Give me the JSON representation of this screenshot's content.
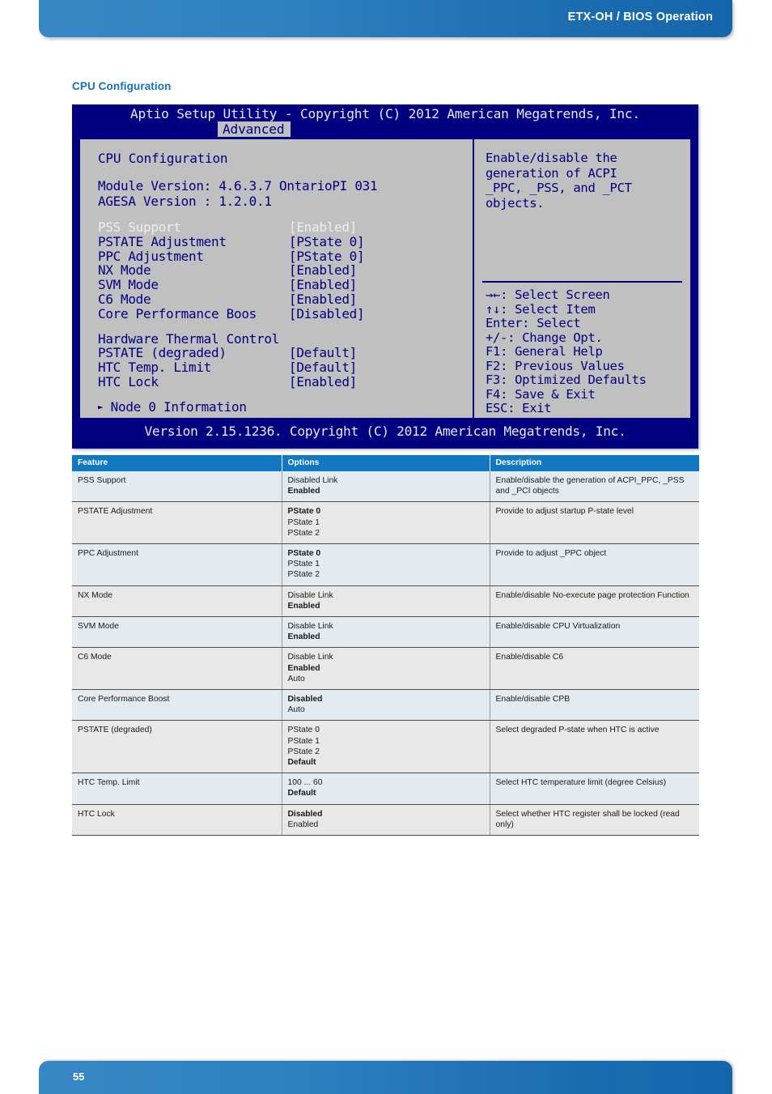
{
  "header": {
    "title": "ETX-OH / BIOS Operation"
  },
  "section": {
    "title": "CPU Configuration"
  },
  "footer": {
    "page_number": "55",
    "accent_color": "#1e6eb2"
  },
  "bios": {
    "title": "Aptio Setup Utility - Copyright (C) 2012 American Megatrends, Inc.",
    "tab": "Advanced",
    "panel_heading": "CPU Configuration",
    "module_version": "Module Version: 4.6.3.7 OntarioPI 031",
    "agesa_version": "AGESA Version : 1.2.0.1",
    "items": [
      {
        "label": "PSS Support",
        "value": "[Enabled]",
        "selected": true
      },
      {
        "label": "PSTATE Adjustment",
        "value": "[PState 0]",
        "selected": false
      },
      {
        "label": "PPC Adjustment",
        "value": "[PState 0]",
        "selected": false
      },
      {
        "label": "NX Mode",
        "value": "[Enabled]",
        "selected": false
      },
      {
        "label": "SVM Mode",
        "value": "[Enabled]",
        "selected": false
      },
      {
        "label": "C6 Mode",
        "value": "[Enabled]",
        "selected": false
      },
      {
        "label": "Core Performance Boos",
        "value": "[Disabled]",
        "selected": false
      }
    ],
    "group_heading": "Hardware Thermal Control",
    "group_items": [
      {
        "label": "PSTATE (degraded)",
        "value": "[Default]"
      },
      {
        "label": "HTC Temp. Limit",
        "value": "[Default]"
      },
      {
        "label": "HTC Lock",
        "value": "[Enabled]"
      }
    ],
    "node_link": "Node 0 Information",
    "help_text": "Enable/disable the\ngeneration of ACPI\n_PPC, _PSS, and _PCT\nobjects.",
    "help_keys": "→←: Select Screen\n↑↓: Select Item\nEnter: Select\n+/-: Change Opt.\nF1: General Help\nF2: Previous Values\nF3: Optimized Defaults\nF4: Save & Exit\nESC: Exit",
    "version_footer": "Version 2.15.1236. Copyright (C) 2012 American Megatrends, Inc.",
    "bg_color": "#000080",
    "panel_color": "#c0c0c0"
  },
  "table": {
    "headers": [
      "Feature",
      "Options",
      "Description"
    ],
    "header_color": "#1179bf",
    "rows": [
      {
        "feature": "PSS Support",
        "options": [
          {
            "text": "Disabled Link",
            "bold": false
          },
          {
            "text": "Enabled",
            "bold": true
          }
        ],
        "description": "Enable/disable the generation of ACPI_PPC, _PSS and _PCI objects"
      },
      {
        "feature": "PSTATE Adjustment",
        "options": [
          {
            "text": "PState 0",
            "bold": true
          },
          {
            "text": "PState 1",
            "bold": false
          },
          {
            "text": "PState 2",
            "bold": false
          }
        ],
        "description": "Provide to adjust startup P-state level"
      },
      {
        "feature": "PPC Adjustment",
        "options": [
          {
            "text": "PState 0",
            "bold": true
          },
          {
            "text": "PState 1",
            "bold": false
          },
          {
            "text": "PState 2",
            "bold": false
          }
        ],
        "description": "Provide to adjust _PPC object"
      },
      {
        "feature": "NX Mode",
        "options": [
          {
            "text": "Disable Link",
            "bold": false
          },
          {
            "text": "Enabled",
            "bold": true
          }
        ],
        "description": "Enable/disable No-execute page protection Function"
      },
      {
        "feature": "SVM Mode",
        "options": [
          {
            "text": "Disable Link",
            "bold": false
          },
          {
            "text": "Enabled",
            "bold": true
          }
        ],
        "description": "Enable/disable CPU Virtualization"
      },
      {
        "feature": "C6 Mode",
        "options": [
          {
            "text": "Disable Link",
            "bold": false
          },
          {
            "text": "Enabled",
            "bold": true
          },
          {
            "text": "Auto",
            "bold": false
          }
        ],
        "description": "Enable/disable C6"
      },
      {
        "feature": "Core Performance Boost",
        "options": [
          {
            "text": "Disabled",
            "bold": true
          },
          {
            "text": "Auto",
            "bold": false
          }
        ],
        "description": "Enable/disable CPB"
      },
      {
        "feature": "PSTATE (degraded)",
        "options": [
          {
            "text": "PState 0",
            "bold": false
          },
          {
            "text": "PState 1",
            "bold": false
          },
          {
            "text": "PState 2",
            "bold": false
          },
          {
            "text": "Default",
            "bold": true
          }
        ],
        "description": "Select degraded P-state when HTC is active"
      },
      {
        "feature": "HTC Temp. Limit",
        "options": [
          {
            "text": "100 ... 60",
            "bold": false
          },
          {
            "text": "Default",
            "bold": true
          }
        ],
        "description": "Select HTC temperature limit (degree Celsius)"
      },
      {
        "feature": "HTC Lock",
        "options": [
          {
            "text": "Disabled",
            "bold": true
          },
          {
            "text": "Enabled",
            "bold": false
          }
        ],
        "description": "Select whether HTC register shall be locked (read only)"
      }
    ]
  }
}
